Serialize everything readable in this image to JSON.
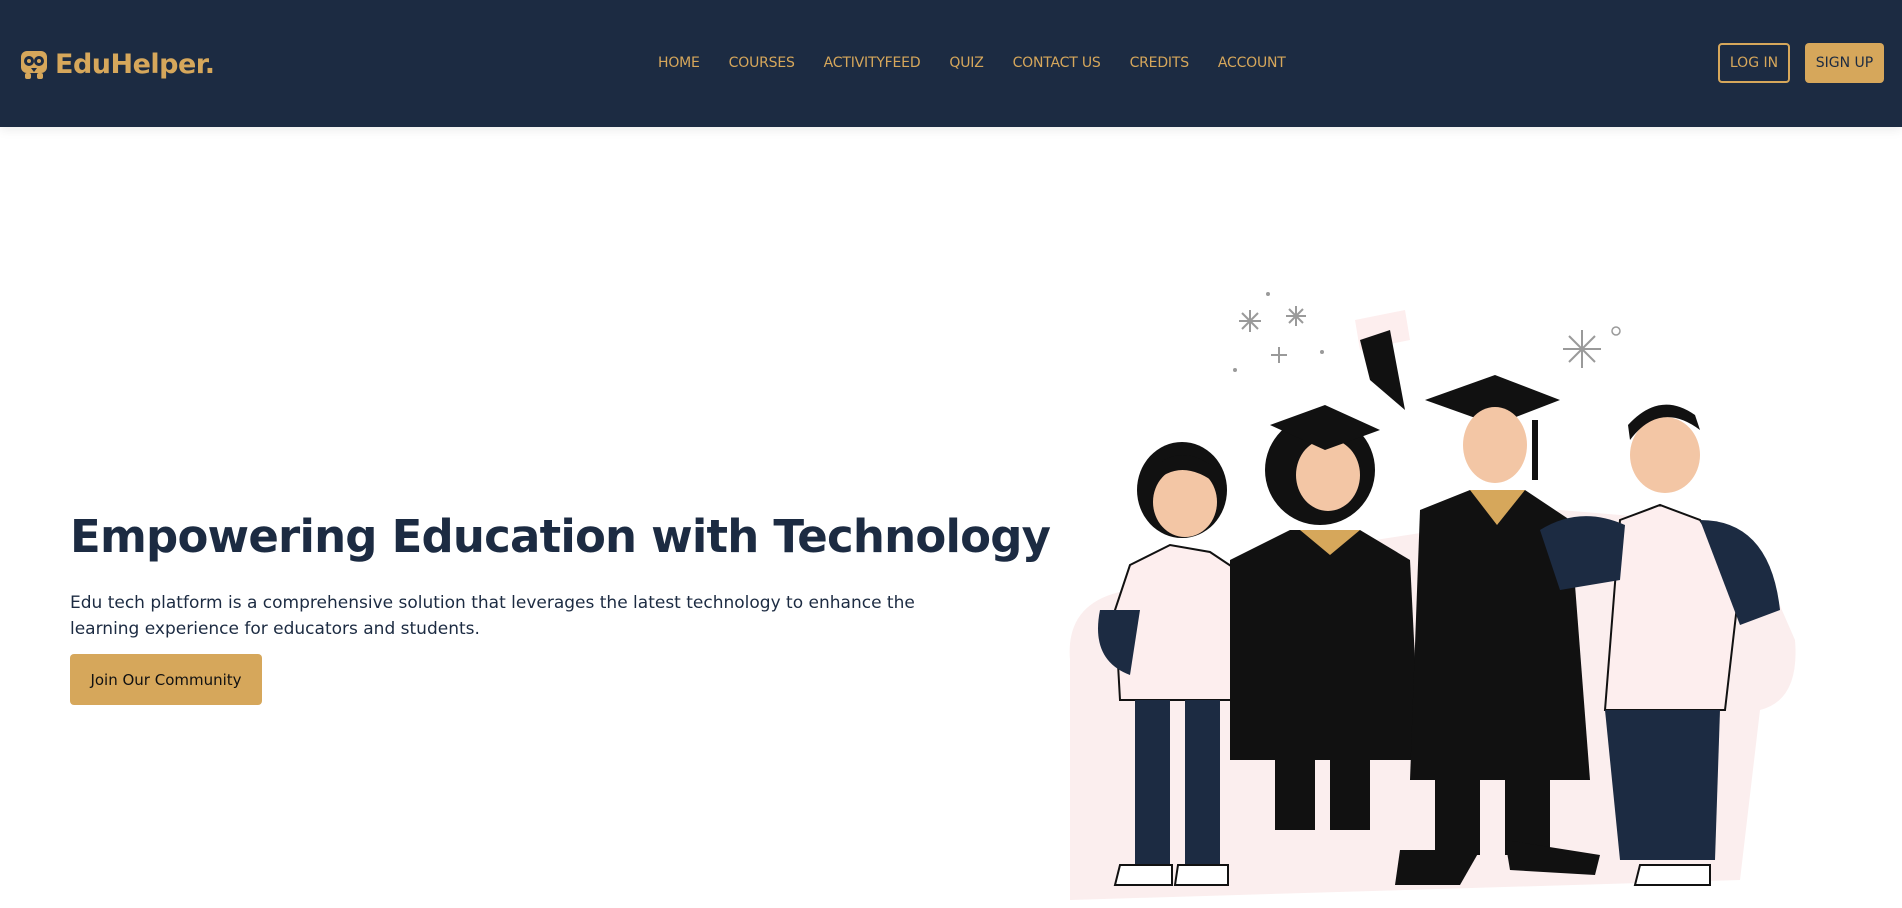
{
  "header": {
    "logo_text": "EduHelper.",
    "logo_icon": "owl-logo-icon",
    "nav": [
      {
        "label": "HOME"
      },
      {
        "label": "COURSES"
      },
      {
        "label": "ACTIVITYFEED"
      },
      {
        "label": "QUIZ"
      },
      {
        "label": "CONTACT US"
      },
      {
        "label": "CREDITS"
      },
      {
        "label": "ACCOUNT"
      }
    ],
    "login_label": "LOG IN",
    "signup_label": "SIGN UP"
  },
  "hero": {
    "title": "Empowering Education with Technology",
    "description": "Edu tech platform is a comprehensive solution that leverages the latest technology to enhance the learning experience for educators and students.",
    "cta_label": "Join Our Community",
    "illustration": "graduating-students-illustration"
  },
  "colors": {
    "navbar_bg": "#1c2b42",
    "accent": "#d6a75b",
    "text_dark": "#1c2b42"
  }
}
